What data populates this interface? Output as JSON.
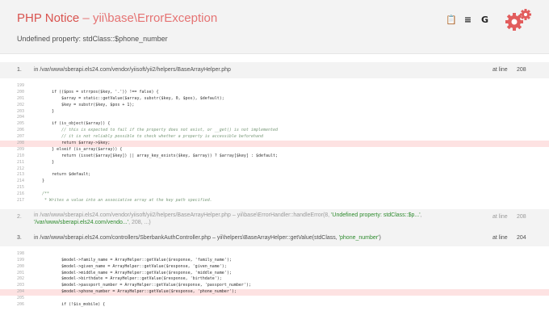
{
  "header": {
    "title_main": "PHP Notice",
    "title_rest": " – yii\\base\\ErrorException",
    "subtitle": "Undefined property: stdClass::$phone_number",
    "tools": [
      {
        "icon": "copy-icon",
        "glyph": "📋"
      },
      {
        "icon": "stackoverflow-icon",
        "glyph": "≡"
      },
      {
        "icon": "google-icon",
        "glyph": "G"
      }
    ]
  },
  "frames": [
    {
      "num": "1.",
      "path": "in /var/www/sberapi.els24.com/vendor/yiisoft/yii2/helpers/BaseArrayHelper.php",
      "at_line_label": "at line",
      "line": "208",
      "code": [
        {
          "n": "199",
          "t": ""
        },
        {
          "n": "200",
          "t": "        if (($pos = strrpos($key, '.')) !== false) {"
        },
        {
          "n": "201",
          "t": "            $array = static::getValue($array, substr($key, 0, $pos), $default);"
        },
        {
          "n": "202",
          "t": "            $key = substr($key, $pos + 1);"
        },
        {
          "n": "203",
          "t": "        }"
        },
        {
          "n": "204",
          "t": ""
        },
        {
          "n": "205",
          "t": "        if (is_object($array)) {"
        },
        {
          "n": "206",
          "t": "            // this is expected to fail if the property does not exist, or __get() is not implemented"
        },
        {
          "n": "207",
          "t": "            // it is not reliably possible to check whether a property is accessible beforehand"
        },
        {
          "n": "208",
          "t": "            return $array->$key;"
        },
        {
          "n": "209",
          "t": "        } elseif (is_array($array)) {"
        },
        {
          "n": "210",
          "t": "            return (isset($array[$key]) || array_key_exists($key, $array)) ? $array[$key] : $default;"
        },
        {
          "n": "211",
          "t": "        }"
        },
        {
          "n": "212",
          "t": ""
        },
        {
          "n": "213",
          "t": "        return $default;"
        },
        {
          "n": "214",
          "t": "    }"
        },
        {
          "n": "215",
          "t": ""
        },
        {
          "n": "216",
          "t": "    /**"
        },
        {
          "n": "217",
          "t": "     * Writes a value into an associative array at the key path specified."
        }
      ]
    },
    {
      "num": "2.",
      "path_a": "in /var/www/sberapi.els24.com/vendor/yiisoft/yii2/helpers/BaseArrayHelper.php",
      "path_b": " – yii\\base\\ErrorHandler::handleError(8, ",
      "path_c": "'Undefined property: stdClass::$p...'",
      "path_d": ", ",
      "path_e": "'/var/www/sberapi.els24.com/vendo...'",
      "path_f": ", 208, ...)",
      "at_line_label": "at line",
      "line": "208"
    },
    {
      "num": "3.",
      "path_a": "in /var/www/sberapi.els24.com/controllers/SberbankAuthController.php",
      "path_b": " – yii\\helpers\\BaseArrayHelper::getValue(stdClass, ",
      "path_c": "'phone_number'",
      "path_d": ")",
      "at_line_label": "at line",
      "line": "204",
      "code": [
        {
          "n": "198",
          "t": ""
        },
        {
          "n": "199",
          "t": "            $model->family_name = ArrayHelper::getValue($response, 'family_name');"
        },
        {
          "n": "200",
          "t": "            $model->given_name = ArrayHelper::getValue($response, 'given_name');"
        },
        {
          "n": "201",
          "t": "            $model->middle_name = ArrayHelper::getValue($response, 'middle_name');"
        },
        {
          "n": "202",
          "t": "            $model->birthdate = ArrayHelper::getValue($response, 'birthdate');"
        },
        {
          "n": "203",
          "t": "            $model->passport_number = ArrayHelper::getValue($response, 'passport_number');"
        },
        {
          "n": "204",
          "t": "            $model->phone_number = ArrayHelper::getValue($response, 'phone_number');"
        },
        {
          "n": "205",
          "t": ""
        },
        {
          "n": "206",
          "t": "            if (!$is_mobile) {"
        }
      ]
    }
  ]
}
